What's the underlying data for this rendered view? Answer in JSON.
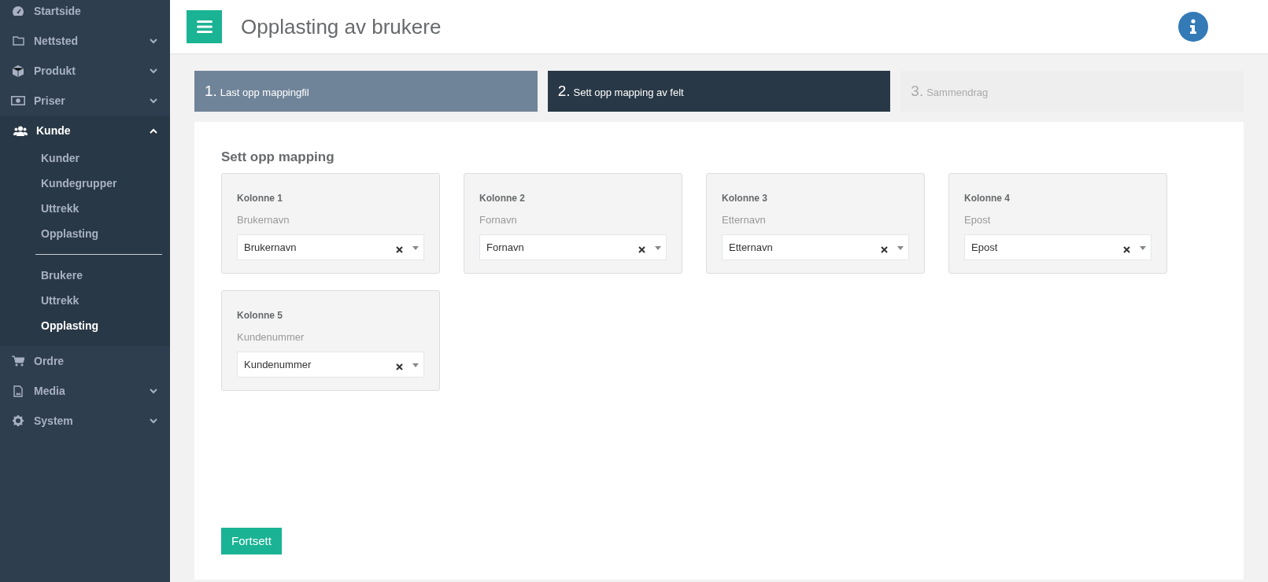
{
  "sidebar": {
    "items": [
      {
        "label": "Startside",
        "expandable": false,
        "expanded": false
      },
      {
        "label": "Nettsted",
        "expandable": true,
        "expanded": false
      },
      {
        "label": "Produkt",
        "expandable": true,
        "expanded": false
      },
      {
        "label": "Priser",
        "expandable": true,
        "expanded": false
      },
      {
        "label": "Kunde",
        "expandable": true,
        "expanded": true,
        "groups": [
          [
            {
              "label": "Kunder",
              "selected": false
            },
            {
              "label": "Kundegrupper",
              "selected": false
            },
            {
              "label": "Uttrekk",
              "selected": false
            },
            {
              "label": "Opplasting",
              "selected": false
            }
          ],
          [
            {
              "label": "Brukere",
              "selected": false
            },
            {
              "label": "Uttrekk",
              "selected": false
            },
            {
              "label": "Opplasting",
              "selected": true
            }
          ]
        ]
      },
      {
        "label": "Ordre",
        "expandable": false,
        "expanded": false
      },
      {
        "label": "Media",
        "expandable": true,
        "expanded": false
      },
      {
        "label": "System",
        "expandable": true,
        "expanded": false
      }
    ]
  },
  "header": {
    "title": "Opplasting av brukere"
  },
  "steps": [
    {
      "number": "1.",
      "label": "Last opp mappingfil",
      "completed": true,
      "selected": false
    },
    {
      "number": "2.",
      "label": "Sett opp mapping av felt",
      "completed": false,
      "selected": true
    },
    {
      "number": "3.",
      "label": "Sammendrag",
      "completed": false,
      "selected": false
    }
  ],
  "mapping": {
    "title": "Sett opp mapping",
    "columns": [
      {
        "heading": "Kolonne 1",
        "source": "Brukernavn",
        "value": "Brukernavn"
      },
      {
        "heading": "Kolonne 2",
        "source": "Fornavn",
        "value": "Fornavn"
      },
      {
        "heading": "Kolonne 3",
        "source": "Etternavn",
        "value": "Etternavn"
      },
      {
        "heading": "Kolonne 4",
        "source": "Epost",
        "value": "Epost"
      },
      {
        "heading": "Kolonne 5",
        "source": "Kundenummer",
        "value": "Kundenummer"
      }
    ]
  },
  "continue_button": "Fortsett"
}
